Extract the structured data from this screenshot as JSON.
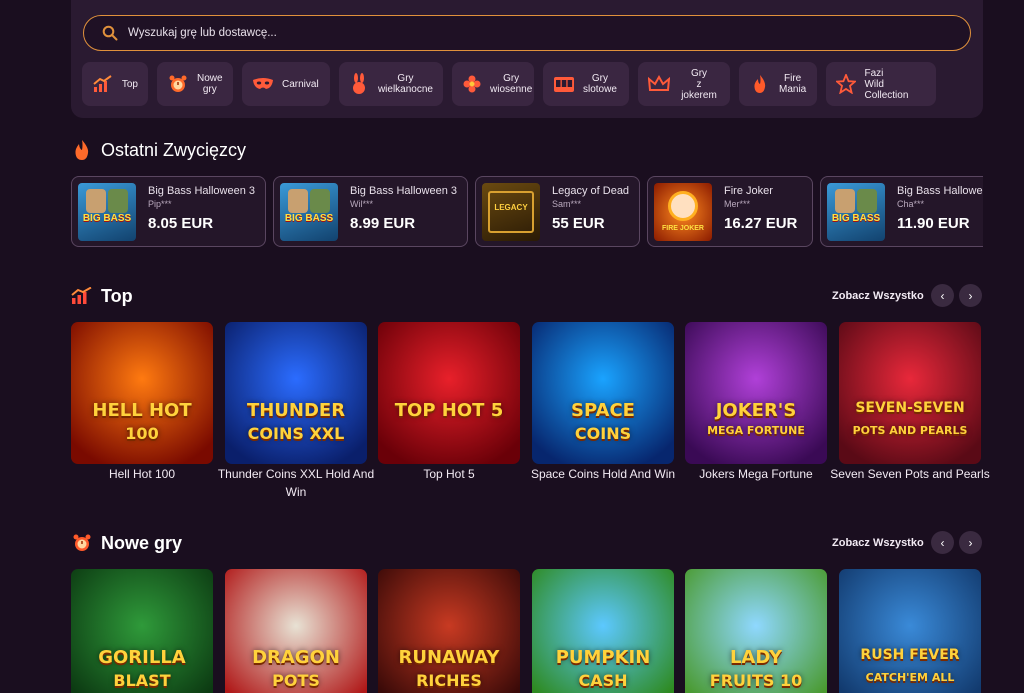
{
  "search": {
    "placeholder": "Wyszukaj grę lub dostawcę..."
  },
  "categories": [
    {
      "lines": [
        "Top"
      ],
      "icon": "chart-icon"
    },
    {
      "lines": [
        "Nowe",
        "gry"
      ],
      "icon": "alarm-clock-icon"
    },
    {
      "lines": [
        "Carnival"
      ],
      "icon": "mask-icon"
    },
    {
      "lines": [
        "Gry",
        "wielkanocne"
      ],
      "icon": "bunny-icon"
    },
    {
      "lines": [
        "Gry",
        "wiosenne"
      ],
      "icon": "flower-icon"
    },
    {
      "lines": [
        "Gry",
        "slotowe"
      ],
      "icon": "slot-machine-icon"
    },
    {
      "lines": [
        "Gry",
        "z jokerem"
      ],
      "icon": "crown-icon"
    },
    {
      "lines": [
        "Fire",
        "Mania"
      ],
      "icon": "fire-icon"
    },
    {
      "lines": [
        "Fazi",
        "Wild Collection"
      ],
      "icon": "star-icon"
    }
  ],
  "winners": {
    "title": "Ostatni Zwycięzcy",
    "items": [
      {
        "game": "Big Bass Halloween 3",
        "user": "Pip***",
        "amount": "8.05 EUR"
      },
      {
        "game": "Big Bass Halloween 3",
        "user": "Wil***",
        "amount": "8.99 EUR"
      },
      {
        "game": "Legacy of Dead",
        "user": "Sam***",
        "amount": "55 EUR"
      },
      {
        "game": "Fire Joker",
        "user": "Mer***",
        "amount": "16.27 EUR"
      },
      {
        "game": "Big Bass Hallowe",
        "user": "Cha***",
        "amount": "11.90 EUR"
      }
    ]
  },
  "top": {
    "title": "Top",
    "see_all": "Zobacz Wszystko",
    "games": [
      {
        "name": "Hell Hot 100",
        "logo": "HELL HOT",
        "logo2": "100",
        "colors": [
          "#ff7a10",
          "#7a0a00"
        ]
      },
      {
        "name": "Thunder Coins XXL Hold And Win",
        "logo": "THUNDER",
        "logo2": "COINS XXL",
        "colors": [
          "#2b6cff",
          "#0a1f6b"
        ]
      },
      {
        "name": "Top Hot 5",
        "logo": "TOP HOT 5",
        "logo2": "",
        "colors": [
          "#e8202a",
          "#6a0008"
        ]
      },
      {
        "name": "Space Coins Hold And Win",
        "logo": "SPACE",
        "logo2": "COINS",
        "colors": [
          "#1aa3ff",
          "#07266e"
        ]
      },
      {
        "name": "Jokers Mega Fortune",
        "logo": "JOKER'S",
        "logo2": "MEGA FORTUNE",
        "colors": [
          "#b040d8",
          "#3a0a55"
        ]
      },
      {
        "name": "Seven Seven Pots and Pearls",
        "logo": "SEVEN-SEVEN",
        "logo2": "POTS AND PEARLS",
        "colors": [
          "#e8283a",
          "#5a0a16"
        ]
      }
    ]
  },
  "new": {
    "title": "Nowe gry",
    "see_all": "Zobacz Wszystko",
    "games": [
      {
        "logo": "GORILLA",
        "logo2": "BLAST",
        "colors": [
          "#2f9a3a",
          "#0c3a12"
        ]
      },
      {
        "logo": "DRAGON",
        "logo2": "POTS",
        "colors": [
          "#e8e2d4",
          "#b01818"
        ]
      },
      {
        "logo": "RUNAWAY",
        "logo2": "RICHES",
        "colors": [
          "#c83a22",
          "#3a0a08"
        ]
      },
      {
        "logo": "PUMPKIN",
        "logo2": "CASH",
        "colors": [
          "#5cc8ff",
          "#2e8a20"
        ]
      },
      {
        "logo": "LADY",
        "logo2": "FRUITS 10",
        "colors": [
          "#8fd8ff",
          "#4a9a30"
        ]
      },
      {
        "logo": "RUSH FEVER",
        "logo2": "CATCH'EM ALL",
        "colors": [
          "#3a8ad8",
          "#123a6e"
        ]
      }
    ]
  },
  "colors": {
    "accent": "#e0913c",
    "bg": "#1a0e1f",
    "panel": "#2a1a31"
  }
}
